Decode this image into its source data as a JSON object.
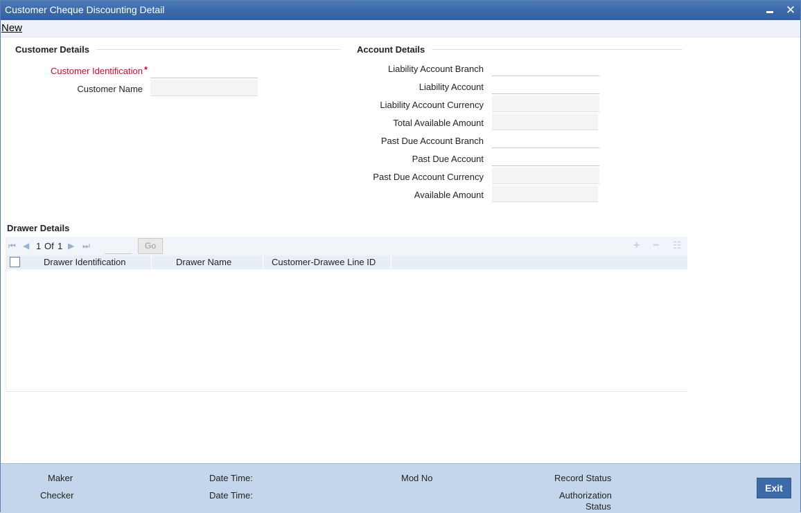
{
  "window": {
    "title": "Customer Cheque Discounting Detail"
  },
  "menu": {
    "new_label": "New"
  },
  "customer_details": {
    "section_title": "Customer Details",
    "customer_identification_label": "Customer Identification",
    "required_marker": "*",
    "customer_identification_value": "",
    "customer_name_label": "Customer Name",
    "customer_name_value": ""
  },
  "account_details": {
    "section_title": "Account Details",
    "fields": [
      {
        "label": "Liability Account Branch",
        "value": ""
      },
      {
        "label": "Liability Account",
        "value": ""
      },
      {
        "label": "Liability Account Currency",
        "value": ""
      },
      {
        "label": "Total Available Amount",
        "value": ""
      },
      {
        "label": "Past Due Account Branch",
        "value": ""
      },
      {
        "label": "Past Due Account",
        "value": ""
      },
      {
        "label": "Past Due Account Currency",
        "value": ""
      },
      {
        "label": "Available Amount",
        "value": ""
      }
    ]
  },
  "drawer_details": {
    "section_title": "Drawer Details",
    "pager": {
      "current_page": "1",
      "of_label": "Of",
      "total_pages": "1",
      "go_label": "Go"
    },
    "columns": [
      "Drawer Identification",
      "Drawer Name",
      "Customer-Drawee Line ID"
    ],
    "rows": []
  },
  "footer": {
    "maker_label": "Maker",
    "checker_label": "Checker",
    "date_time_label_1": "Date Time:",
    "date_time_label_2": "Date Time:",
    "mod_no_label": "Mod No",
    "record_status_label": "Record Status",
    "authorization_label": "Authorization",
    "status_label": "Status",
    "exit_label": "Exit"
  },
  "colors": {
    "title_bar": "#2f5f9f",
    "footer_bg": "#c3d6eb",
    "required_red": "#c7102d",
    "exit_button": "#3b6aa6"
  }
}
